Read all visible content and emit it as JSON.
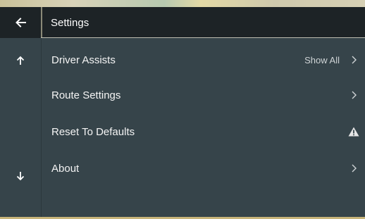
{
  "header": {
    "title": "Settings"
  },
  "menu": {
    "items": [
      {
        "label": "Driver Assists",
        "value": "Show All",
        "icon": "chevron-right-icon"
      },
      {
        "label": "Route Settings",
        "value": "",
        "icon": "chevron-right-icon"
      },
      {
        "label": "Reset To Defaults",
        "value": "",
        "icon": "warning-icon"
      },
      {
        "label": "About",
        "value": "",
        "icon": "chevron-right-icon"
      }
    ]
  },
  "icons": {
    "back": "arrow-left-icon",
    "scroll_up": "arrow-up-icon",
    "scroll_down": "arrow-down-icon"
  },
  "colors": {
    "header_bg": "#1d2326",
    "panel_bg": "#36444a",
    "text": "#f4f4f4",
    "secondary_text": "#cfd4d6"
  }
}
